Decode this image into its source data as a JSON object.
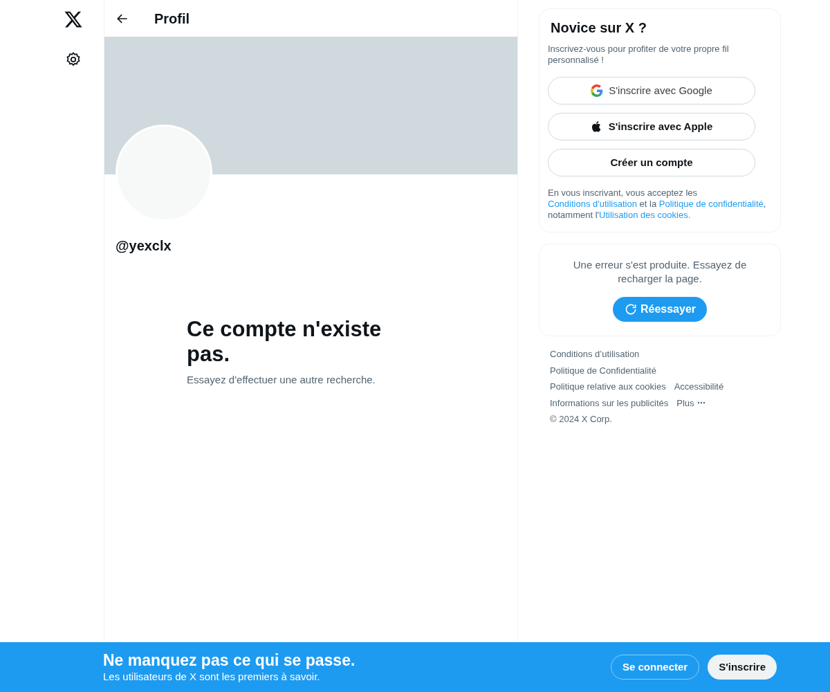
{
  "header": {
    "title": "Profil"
  },
  "profile": {
    "handle": "@yexclx"
  },
  "empty_state": {
    "title": "Ce compte n'existe pas.",
    "subtitle": "Essayez d'effectuer une autre recherche."
  },
  "signup_card": {
    "title": "Novice sur X ?",
    "subtitle": "Inscrivez-vous pour profiter de votre propre fil personnalisé !",
    "buttons": [
      {
        "kind": "google",
        "label": "S'inscrire avec Google"
      },
      {
        "kind": "apple",
        "label": "S'inscrire avec Apple"
      },
      {
        "kind": "plain",
        "label": "Créer un compte"
      }
    ],
    "legal": [
      {
        "text": "En vous inscrivant, vous acceptez les ",
        "kind": "text"
      },
      {
        "text": "Conditions d'utilisation",
        "kind": "link"
      },
      {
        "text": " et la ",
        "kind": "text"
      },
      {
        "text": "Politique de confidentialité",
        "kind": "link"
      },
      {
        "text": ", notamment l'",
        "kind": "text"
      },
      {
        "text": "Utilisation des cookies.",
        "kind": "link"
      }
    ]
  },
  "error_card": {
    "message": "Une erreur s'est produite. Essayez de recharger la page.",
    "retry": "Réessayer"
  },
  "footer_links": [
    [
      {
        "label": "Conditions d’utilisation",
        "kind": "link"
      }
    ],
    [
      {
        "label": "Politique de Confidentialité",
        "kind": "link"
      }
    ],
    [
      {
        "label": "Politique relative aux cookies",
        "kind": "link"
      },
      {
        "label": "Accessibilité",
        "kind": "link"
      }
    ],
    [
      {
        "label": "Informations sur les publicités",
        "kind": "link"
      },
      {
        "label": "Plus",
        "kind": "more"
      }
    ]
  ],
  "copyright": "© 2024 X Corp.",
  "banner": {
    "title": "Ne manquez pas ce qui se passe.",
    "subtitle": "Les utilisateurs de X sont les premiers à savoir.",
    "login": "Se connecter",
    "signup": "S'inscrire"
  }
}
